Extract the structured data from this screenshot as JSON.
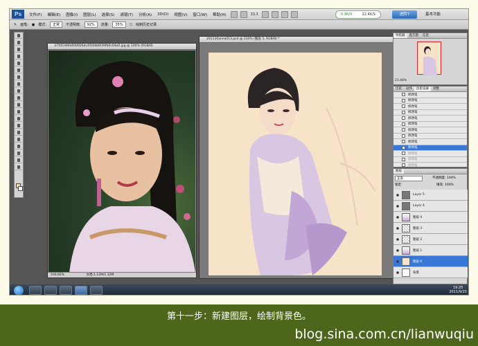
{
  "menubar": {
    "logo": "Ps",
    "items": [
      "文件(F)",
      "编辑(E)",
      "图像(I)",
      "图层(L)",
      "选择(S)",
      "滤镜(T)",
      "分析(A)",
      "3D(D)",
      "视图(V)",
      "窗口(W)",
      "帮助(H)"
    ],
    "zoom": "33.3",
    "status_left": "0.9K/S",
    "status_right": "22.4K/S",
    "cs_button": "进阶7",
    "workspace": "基本功能"
  },
  "options": {
    "brush_label": "画笔:",
    "mode_label": "模式:",
    "mode_value": "正常",
    "opacity_label": "不透明度:",
    "opacity_value": "92%",
    "flow_label": "流量:",
    "flow_value": "35%",
    "airbrush_label": "绘制历史记录"
  },
  "doc1": {
    "title": "b7fd5366d500926dc45f44b6f39fb0c04a0.jpg @ 100% (RGB/8)",
    "zoom": "100.82%",
    "info": "文档:1.12M/1.12M"
  },
  "doc2": {
    "title": "201130anna013.psd @ 233% (图层 5, RGB/8) *"
  },
  "navigator": {
    "tabs": [
      "导航器",
      "直方图",
      "信息"
    ],
    "zoom": "23.48%"
  },
  "history": {
    "tabs": [
      "历史",
      "动作",
      "历史记录",
      "调整"
    ],
    "rows": [
      {
        "label": "修改笔",
        "state": "normal"
      },
      {
        "label": "修改笔",
        "state": "normal"
      },
      {
        "label": "修改笔",
        "state": "normal"
      },
      {
        "label": "修改笔",
        "state": "normal"
      },
      {
        "label": "修改笔",
        "state": "normal"
      },
      {
        "label": "修改笔",
        "state": "normal"
      },
      {
        "label": "修改笔",
        "state": "normal"
      },
      {
        "label": "修改笔",
        "state": "normal"
      },
      {
        "label": "修改笔",
        "state": "normal"
      },
      {
        "label": "修改笔",
        "state": "sel"
      },
      {
        "label": "修改笔",
        "state": "dim"
      },
      {
        "label": "修改笔",
        "state": "dim"
      },
      {
        "label": "修改笔",
        "state": "dim"
      }
    ]
  },
  "layers": {
    "tabs": [
      "图层"
    ],
    "mode": "正常",
    "opacity_label": "不透明度:",
    "opacity_value": "100%",
    "lock_label": "锁定:",
    "fill_label": "填充:",
    "fill_value": "100%",
    "rows": [
      {
        "name": "Layer 5",
        "thumb": "gray",
        "sel": false
      },
      {
        "name": "Layer 4",
        "thumb": "gray",
        "sel": false
      },
      {
        "name": "图层 4",
        "thumb": "fig",
        "sel": false
      },
      {
        "name": "图层 3",
        "thumb": "check",
        "sel": false
      },
      {
        "name": "图层 2",
        "thumb": "check",
        "sel": false
      },
      {
        "name": "图层 1",
        "thumb": "fig",
        "sel": false
      },
      {
        "name": "图层 0",
        "thumb": "cream",
        "sel": true
      },
      {
        "name": "背景",
        "thumb": "white",
        "sel": false
      }
    ]
  },
  "taskbar": {
    "time": "19:25",
    "date": "2011/9/25"
  },
  "caption": "第十一步：新建图层，绘制背景色。",
  "watermark": "blog.sina.com.cn/lianwuqiu",
  "colors": {
    "caption_band": "#4e651c",
    "selection": "#3a78d8",
    "canvas_bg": "#f7e4c8"
  }
}
